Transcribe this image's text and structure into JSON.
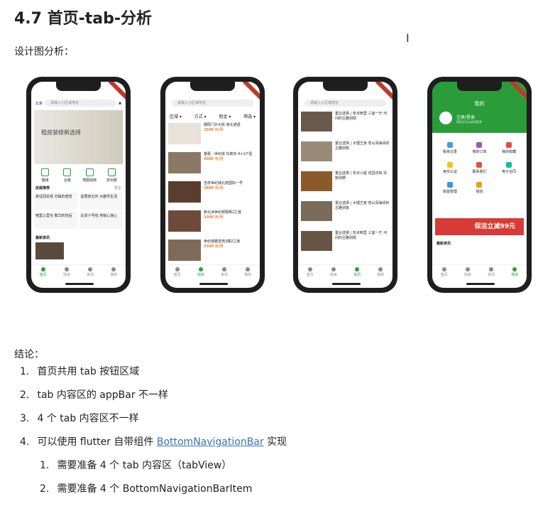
{
  "title": "4.7 首页-tab-分析",
  "subtitle": "设计图分析：",
  "conclusion_label": "结论：",
  "items": [
    {
      "num": "1.",
      "text": "首页共用 tab 按钮区域"
    },
    {
      "num": "2.",
      "text": "tab 内容区的 appBar 不一样"
    },
    {
      "num": "3.",
      "text": "4 个 tab 内容区不一样"
    },
    {
      "num": "4.",
      "text_before": "可以使用 flutter 自带组件 ",
      "link": "BottomNavigationBar",
      "text_after": " 实现"
    }
  ],
  "subitems": [
    {
      "num": "1.",
      "text": "需要准备 4 个 tab 内容区（tabView）"
    },
    {
      "num": "2.",
      "text": "需要准备 4 个 BottomNavigationBarItem"
    }
  ],
  "tabs": [
    "首页",
    "找房",
    "资讯",
    "我的"
  ],
  "phone1": {
    "city": "北京",
    "search_placeholder": "请输入小区或地址",
    "banner": "租房装修新选择",
    "nav": [
      "整租",
      "合租",
      "地图找房",
      "去出租"
    ],
    "section1": "房屋推荐",
    "more": "更多",
    "cards": [
      "家住回龙观 归属的感觉",
      "宜居四五环 大都市生活",
      "喧嚣三里屯 繁华的背后",
      "比邻十号线 地铁心连心"
    ],
    "section2": "最新资讯"
  },
  "phone2": {
    "filters": [
      "区域 ▾",
      "方式 ▾",
      "租金 ▾",
      "筛选 ▾"
    ],
    "listings": [
      {
        "title": "朝阳门外大街 南北通透",
        "price": "2500 元/月"
      },
      {
        "title": "整租 · 世纪城 东南向 4+1户型",
        "price": "4000 元/月"
      },
      {
        "title": "吉祥世纪城北苑国际一号",
        "price": "3800 元/月"
      },
      {
        "title": "新北洲世纪城银辉2之宫",
        "price": "3300 元/月"
      },
      {
        "title": "世纪城春雷苑3期2之宫",
        "price": "3300 元/月"
      }
    ]
  },
  "phone3": {
    "news": [
      "置业选择 | 安贞西里 三室一厅 河间的古雅别院",
      "置业选择 | 大理王宫 苍山洱海间的古雅别院",
      "置业选择 | 安贞小屋 花园洋房 清新别野",
      "置业选择 | 大理王宫 苍山洱海间的古雅别院",
      "置业选择 | 安贞西里 三室一厅 河间的古雅别院"
    ]
  },
  "phone4": {
    "header": "我的",
    "login": "注册/登录",
    "login_hint": "登陆后可以体验更多",
    "menu": [
      "看房记录",
      "我的订单",
      "我的收藏",
      "身份认证",
      "联系我们",
      "电子合同",
      "房屋管理",
      "钱包"
    ],
    "ad": "保洁立减99元",
    "section": "最新资讯"
  },
  "colors": {
    "accent": "#2a9d3a",
    "link": "#3b6fb6",
    "price": "#e67e22"
  }
}
